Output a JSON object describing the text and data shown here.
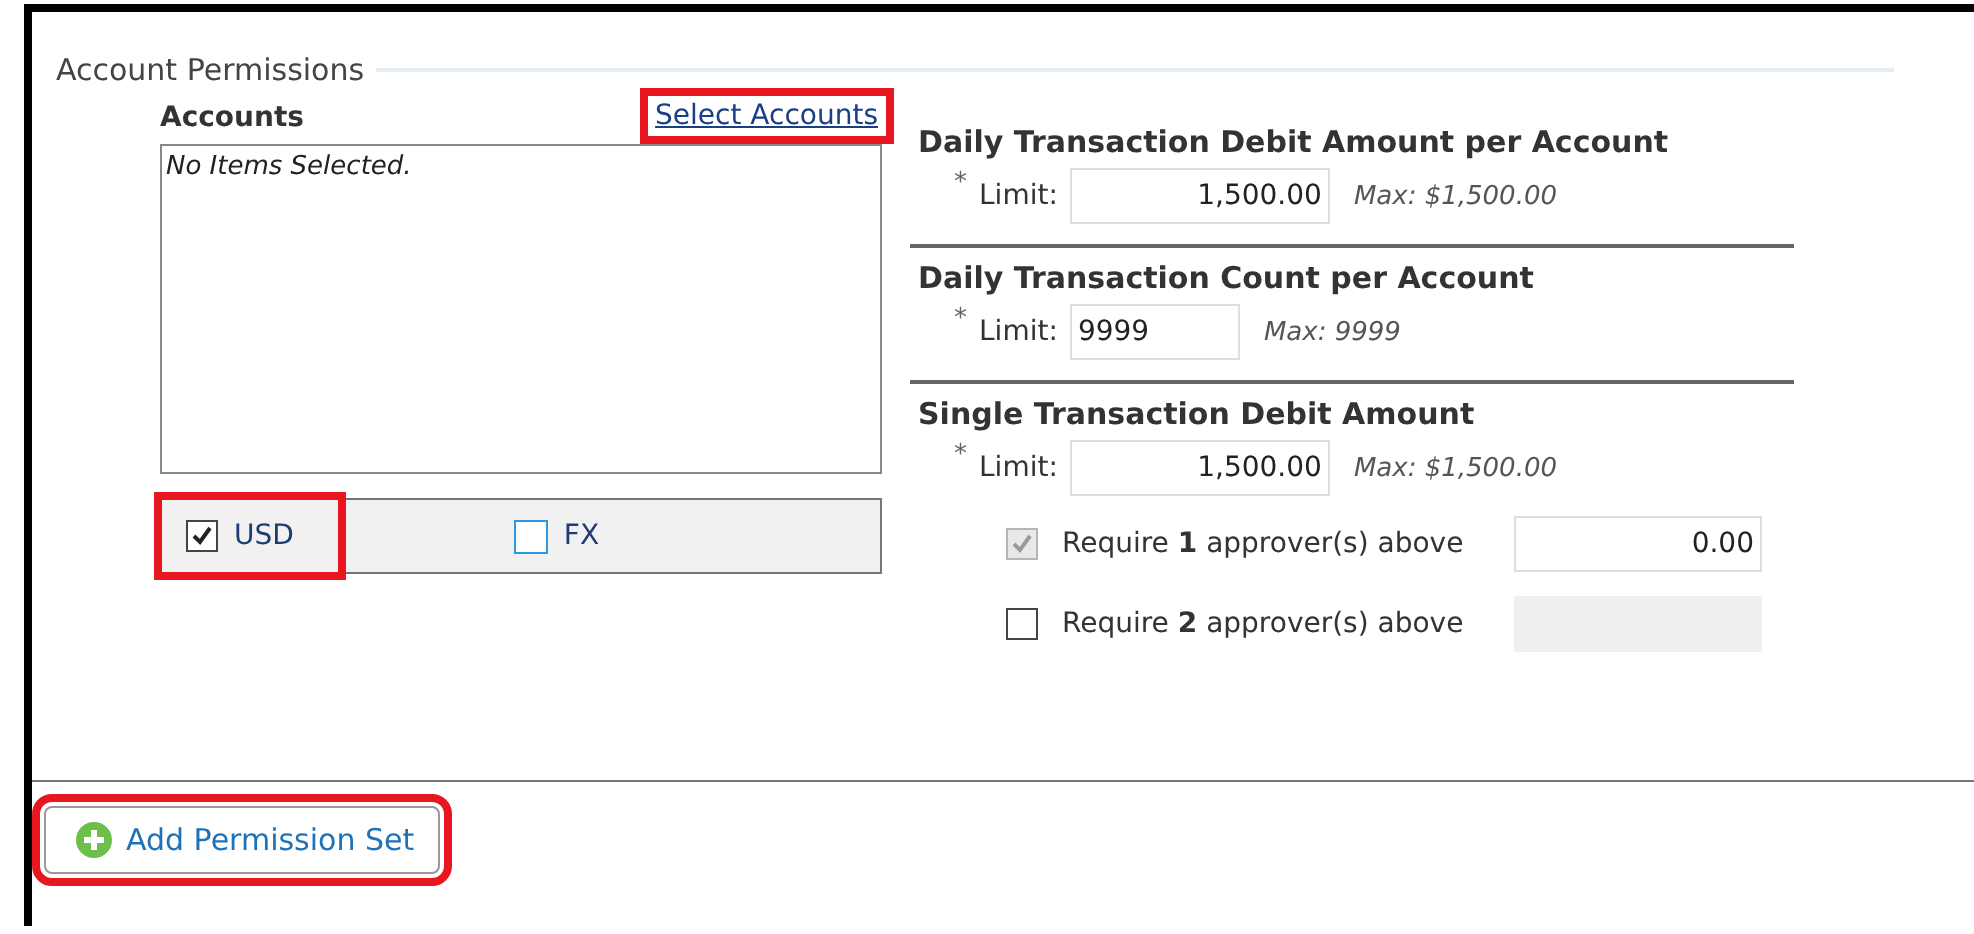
{
  "section": {
    "title": "Account Permissions"
  },
  "accounts": {
    "label": "Accounts",
    "link": {
      "label": "Select Accounts",
      "highlighted": true
    },
    "empty_text": "No Items Selected.",
    "currencies": [
      {
        "label": "USD",
        "checked": true,
        "highlighted": true
      },
      {
        "label": "FX",
        "checked": false,
        "highlighted": false
      }
    ]
  },
  "limits": [
    {
      "title": "Daily Transaction Debit Amount per Account",
      "required": "*",
      "label": "Limit:",
      "kind": "amount",
      "value": "1,500.00",
      "max": "Max: $1,500.00"
    },
    {
      "title": "Daily Transaction Count per Account",
      "required": "*",
      "label": "Limit:",
      "kind": "count",
      "value": "9999",
      "max": "Max: 9999"
    },
    {
      "title": "Single Transaction Debit Amount",
      "required": "*",
      "label": "Limit:",
      "kind": "amount",
      "value": "1,500.00",
      "max": "Max: $1,500.00"
    }
  ],
  "approvers": [
    {
      "label": "Require **1** approver(s) above",
      "checked": true,
      "disabled": true,
      "field_disabled": false,
      "value": "0.00"
    },
    {
      "label": "Require **2** approver(s) above",
      "checked": false,
      "disabled": false,
      "field_disabled": true
    }
  ],
  "add_button": {
    "label": "Add Permission Set",
    "highlighted": true
  }
}
